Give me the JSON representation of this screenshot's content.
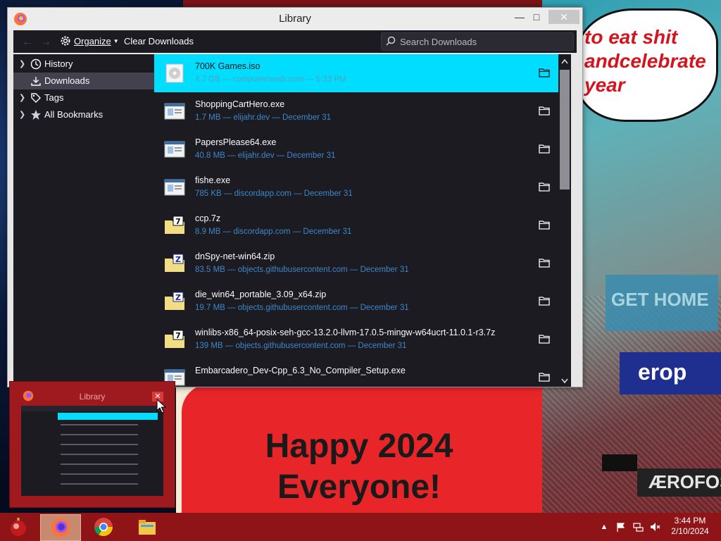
{
  "window": {
    "title": "Library",
    "controls": {
      "minimize": "—",
      "maximize": "□",
      "close": "✕"
    }
  },
  "toolbar": {
    "back_icon": "arrow-left-icon",
    "forward_icon": "arrow-right-icon",
    "organize_label": "Organize",
    "clear_label": "Clear Downloads",
    "search_placeholder": "Search Downloads"
  },
  "sidebar": {
    "items": [
      {
        "label": "History",
        "icon": "clock-icon",
        "selected": false
      },
      {
        "label": "Downloads",
        "icon": "download-icon",
        "selected": true
      },
      {
        "label": "Tags",
        "icon": "tag-icon",
        "selected": false
      },
      {
        "label": "All Bookmarks",
        "icon": "star-icon",
        "selected": false
      }
    ]
  },
  "downloads": [
    {
      "name": "700K Games.iso",
      "meta": "4.7 GB — computernewb.com — 5:33 PM",
      "type": "disc",
      "selected": true
    },
    {
      "name": "ShoppingCartHero.exe",
      "meta": "1.7 MB — elijahr.dev — December 31",
      "type": "exe"
    },
    {
      "name": "PapersPlease64.exe",
      "meta": "40.8 MB — elijahr.dev — December 31",
      "type": "exe"
    },
    {
      "name": "fishe.exe",
      "meta": "785 KB — discordapp.com — December 31",
      "type": "exe"
    },
    {
      "name": "ccp.7z",
      "meta": "8.9 MB — discordapp.com — December 31",
      "type": "7z"
    },
    {
      "name": "dnSpy-net-win64.zip",
      "meta": "83.5 MB — objects.githubusercontent.com — December 31",
      "type": "zip"
    },
    {
      "name": "die_win64_portable_3.09_x64.zip",
      "meta": "19.7 MB — objects.githubusercontent.com — December 31",
      "type": "zip"
    },
    {
      "name": "winlibs-x86_64-posix-seh-gcc-13.2.0-llvm-17.0.5-mingw-w64ucrt-11.0.1-r3.7z",
      "meta": "139 MB — objects.githubusercontent.com — December 31",
      "type": "7z"
    },
    {
      "name": "Embarcadero_Dev-Cpp_6.3_No_Compiler_Setup.exe",
      "meta": "",
      "type": "exe"
    }
  ],
  "preview": {
    "title": "Library",
    "close": "✕"
  },
  "wallpaper": {
    "bubble_line1": "to eat shit",
    "bubble_line2": "andcelebrate",
    "bubble_line3": "year",
    "happy_line1": "Happy 2024",
    "happy_line2": "Everyone!",
    "sign1": "GET HOME",
    "sign2": "erop",
    "sign3": "ÆROFOS"
  },
  "taskbar": {
    "apps": [
      "firefox-icon",
      "chrome-icon",
      "file-explorer-icon"
    ],
    "time": "3:44 PM",
    "date": "2/10/2024"
  },
  "colors": {
    "accent": "#00ddff",
    "meta_text": "#3d87c9",
    "panel": "#1c1b22",
    "taskbar": "#8e1418"
  }
}
